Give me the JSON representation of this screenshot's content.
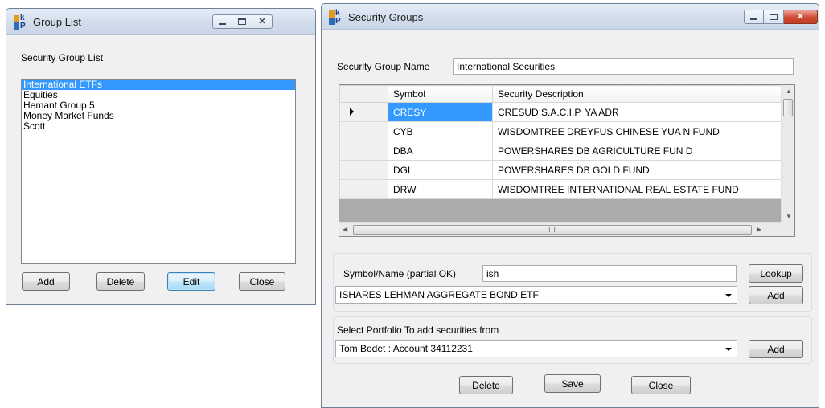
{
  "group_list_window": {
    "title": "Group List",
    "heading": "Security Group List",
    "items": [
      "International ETFs",
      "Equities",
      "Hemant Group 5",
      "Money Market Funds",
      "Scott"
    ],
    "selected_index": 0,
    "buttons": {
      "add": "Add",
      "delete": "Delete",
      "edit": "Edit",
      "close": "Close"
    }
  },
  "security_groups_window": {
    "title": "Security Groups",
    "group_name_label": "Security Group Name",
    "group_name_value": "International Securities",
    "grid": {
      "columns": [
        "Symbol",
        "Security Description"
      ],
      "rows": [
        {
          "symbol": "CRESY",
          "description": "CRESUD S.A.C.I.P. YA ADR"
        },
        {
          "symbol": "CYB",
          "description": "WISDOMTREE DREYFUS CHINESE YUA N FUND"
        },
        {
          "symbol": "DBA",
          "description": "POWERSHARES DB AGRICULTURE FUN D"
        },
        {
          "symbol": "DGL",
          "description": "POWERSHARES DB GOLD FUND"
        },
        {
          "symbol": "DRW",
          "description": "WISDOMTREE INTERNATIONAL REAL ESTATE FUND"
        }
      ],
      "current_row": 0
    },
    "lookup": {
      "label": "Symbol/Name (partial OK)",
      "value": "ish",
      "button": "Lookup",
      "result_selected": "ISHARES LEHMAN AGGREGATE BOND ETF",
      "add_button": "Add"
    },
    "portfolio": {
      "label": "Select Portfolio To add securities from",
      "selected": "Tom Bodet : Account 34112231",
      "add_button": "Add"
    },
    "buttons": {
      "delete": "Delete",
      "save": "Save",
      "close": "Close"
    }
  },
  "colors": {
    "selection": "#3399ff",
    "close_button": "#c33d25",
    "window_bg": "#f0f0f0"
  },
  "icons": [
    "app-logo-icon",
    "minimize-icon",
    "maximize-icon",
    "close-icon",
    "row-pointer-icon",
    "dropdown-arrow-icon",
    "scroll-up-icon",
    "scroll-down-icon",
    "scroll-left-icon",
    "scroll-right-icon"
  ]
}
